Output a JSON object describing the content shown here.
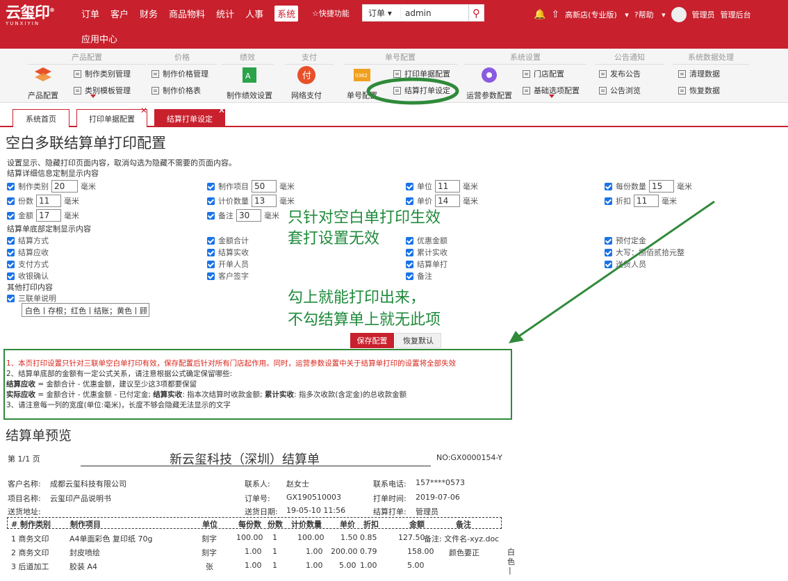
{
  "brand": {
    "logo_text": "云玺印",
    "logo_sub": "YUNXIYIN",
    "reg": "®"
  },
  "nav": {
    "items": [
      "订单",
      "客户",
      "财务",
      "商品物料",
      "统计",
      "人事",
      "系统"
    ],
    "active": "系统",
    "second_row": "应用中心",
    "quick": "☆快捷功能"
  },
  "search": {
    "type": "订单",
    "value": "admin"
  },
  "right": {
    "store": "高新店(专业版)",
    "help": "?帮助",
    "user": "管理员",
    "admin": "管理后台"
  },
  "ribbon": {
    "groups": [
      {
        "title": "产品配置"
      },
      {
        "title": "价格"
      },
      {
        "title": "绩效"
      },
      {
        "title": "支付"
      },
      {
        "title": "单号配置"
      },
      {
        "title": "系统设置"
      },
      {
        "title": "公告通知"
      },
      {
        "title": "系统数据处理"
      }
    ],
    "big": {
      "product": "产品配置",
      "perf": "制作绩效设置",
      "pay": "网络支付",
      "number": "单号配置",
      "ops": "运营参数配置"
    },
    "small": {
      "make_cat": "制作类别管理",
      "cat_tpl": "类别模板管理",
      "price_mgr": "制作价格管理",
      "price_tbl": "制作价格表",
      "print_cfg": "打印单据配置",
      "settle_cfg": "结算打单设定",
      "store": "门店配置",
      "basic": "基础选项配置",
      "post": "发布公告",
      "browse": "公告浏览",
      "clean": "清理数据",
      "restore": "恢复数据"
    },
    "pay_glyph": "付",
    "number_badge": "0362"
  },
  "tabs": {
    "home": "系统首页",
    "print": "打印单据配置",
    "settle": "结算打单设定"
  },
  "page": {
    "title": "空白多联结算单打印配置",
    "intro": "设置显示、隐藏打印页面内容，取消勾选为隐藏不需要的页面内容。",
    "sec1": "结算详细信息定制显示内容",
    "sec2": "结算单底部定制显示内容",
    "sec3": "其他打印内容",
    "unit": "毫米",
    "detail": [
      {
        "label": "制作类别",
        "value": "20"
      },
      {
        "label": "制作项目",
        "value": "50"
      },
      {
        "label": "单位",
        "value": "11"
      },
      {
        "label": "每份数量",
        "value": "15"
      },
      {
        "label": "份数",
        "value": "11"
      },
      {
        "label": "计价数量",
        "value": "13"
      },
      {
        "label": "单价",
        "value": "14"
      },
      {
        "label": "折扣",
        "value": "11"
      },
      {
        "label": "金额",
        "value": "17"
      },
      {
        "label": "备注",
        "value": "30"
      }
    ],
    "bottom": [
      "结算方式",
      "金额合计",
      "优惠金额",
      "预付定金",
      "结算应收",
      "结算实收",
      "累计实收",
      "大写：捌佰贰拾元整",
      "支付方式",
      "开单人员",
      "结算单打",
      "送货人员",
      "收银确认",
      "客户签字",
      "备注"
    ],
    "other_label": "三联单说明",
    "other_text": "白色丨存根；红色丨结账；黄色丨顾",
    "save": "保存配置",
    "reset": "恢复默认"
  },
  "annotations": {
    "a1": "只针对空白单打印生效",
    "a2": "套打设置无效",
    "a3": "勾上就能打印出来，",
    "a4": "不勾结算单上就无此项"
  },
  "notice": {
    "l1": "1、本页打印设置只针对三联单空白单打印有效，保存配置后针对所有门店起作用。同时，运营参数设置中关于结算单打印的设置将全部失效",
    "l2": "2、结算单底部的金额有一定公式关系，请注意根据公式确定保留哪些:",
    "l3b": "结算应收",
    "l3": " = 金额合计 - 优惠金额，建议至少这3项都要保留",
    "l4b": "实际应收",
    "l4a": " = 金额合计 - 优惠金额 - 已付定金; ",
    "l4c": "结算实收",
    "l4d": ": 指本次结算时收款金额; ",
    "l4e": "累计实收",
    "l4f": ": 指多次收款(含定金)的总收款金额",
    "l5": "3、请注意每一列的宽度(单位:毫米)，长度不够会隐藏无法显示的文字"
  },
  "preview": {
    "title": "结算单预览",
    "page": "第 1/1 页",
    "doc_title": "新云玺科技（深圳）结算单",
    "no": "NO:GX0000154-Y",
    "customer_label": "客户名称:",
    "customer": "成都云玺科技有限公司",
    "contact_label": "联系人:",
    "contact": "赵女士",
    "phone_label": "联系电话:",
    "phone": "157****0573",
    "project_label": "项目名称:",
    "project": "云玺印产品说明书",
    "order_label": "订单号:",
    "order": "GX190510003",
    "print_time_label": "打单时间:",
    "print_time": "2019-07-06",
    "addr_label": "送货地址:",
    "delivery_label": "送货日期:",
    "delivery": "19-05-10 11:56",
    "printer_label": "结算打单:",
    "printer": "管理员",
    "headers": [
      "# 制作类别",
      "制作项目",
      "单位",
      "每份数",
      "份数",
      "计价数量",
      "单价",
      "折扣",
      "金额",
      "备注"
    ],
    "rows": [
      [
        "1 商务文印",
        "A4单面彩色 复印纸 70g",
        "刻字",
        "100.00",
        "1",
        "100.00",
        "1.50",
        "0.85",
        "127.50",
        "备注: 文件名-xyz.doc"
      ],
      [
        "2 商务文印",
        "封皮喷绘",
        "刻字",
        "1.00",
        "1",
        "1.00",
        "200.00",
        "0.79",
        "158.00",
        "颜色要正"
      ],
      [
        "3 后道加工",
        "胶装 A4",
        "张",
        "1.00",
        "1",
        "1.00",
        "5.00",
        "1.00",
        "5.00",
        ""
      ]
    ],
    "side_text": [
      "白",
      "色",
      "|"
    ]
  }
}
